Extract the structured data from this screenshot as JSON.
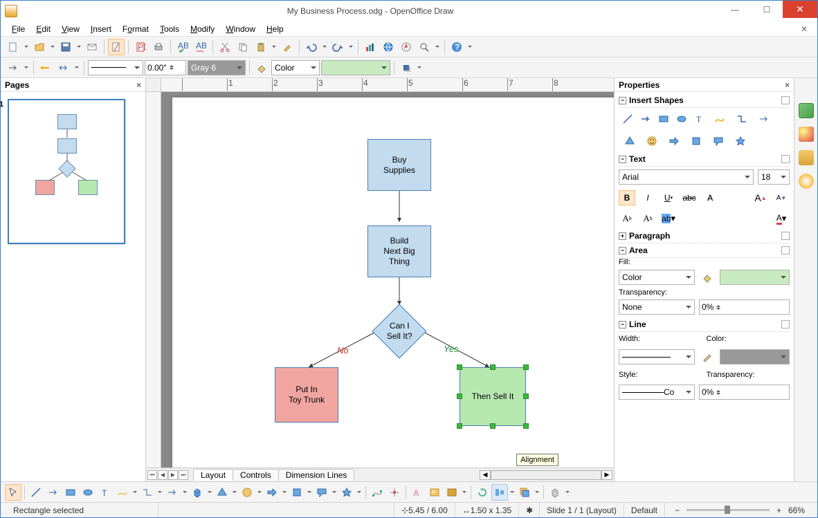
{
  "title": "My Business Process.odg - OpenOffice Draw",
  "menus": [
    "File",
    "Edit",
    "View",
    "Insert",
    "Format",
    "Tools",
    "Modify",
    "Window",
    "Help"
  ],
  "toolbar2": {
    "lineWidth": "0.00\"",
    "lineColorName": "Gray 6",
    "fillType": "Color"
  },
  "pagesPanel": {
    "title": "Pages",
    "page1": "1"
  },
  "flow": {
    "buy": "Buy\nSupplies",
    "build": "Build\nNext Big\nThing",
    "decide": "Can I\nSell It?",
    "no": "No",
    "yes": "Yes",
    "put": "Put In\nToy Trunk",
    "sell": "Then Sell It"
  },
  "tabs": {
    "layout": "Layout",
    "controls": "Controls",
    "dims": "Dimension Lines"
  },
  "tooltip": "Alignment",
  "props": {
    "title": "Properties",
    "insertShapes": "Insert Shapes",
    "text": "Text",
    "fontName": "Arial",
    "fontSize": "18",
    "paragraph": "Paragraph",
    "area": "Area",
    "fillLabel": "Fill:",
    "fillType": "Color",
    "transparencyLabel": "Transparency:",
    "transparencyType": "None",
    "transparencyVal": "0%",
    "line": "Line",
    "widthLabel": "Width:",
    "colorLabel": "Color:",
    "styleLabel": "Style:",
    "styleVal": "Co",
    "lineTranspLabel": "Transparency:",
    "lineTranspVal": "0%"
  },
  "status": {
    "sel": "Rectangle selected",
    "pos": "5.45 / 6.00",
    "size": "1.50 x 1.35",
    "slide": "Slide 1 / 1 (Layout)",
    "style": "Default",
    "zoom": "66%"
  }
}
